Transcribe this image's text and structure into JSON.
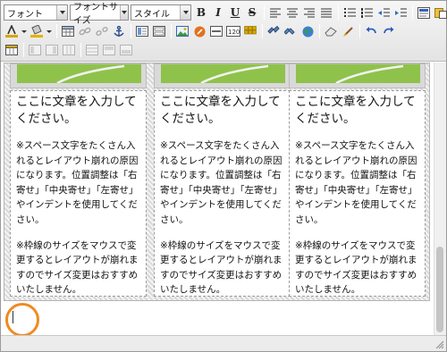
{
  "toolbar": {
    "font_select": "フォント",
    "size_select": "フォントサイズ",
    "style_select": "スタイル",
    "bold_label": "B",
    "italic_label": "I",
    "underline_label": "U",
    "strike_label": "S",
    "icons_row1": [
      "bold-icon",
      "italic-icon",
      "underline-icon",
      "strikethrough-icon",
      "align-left-icon",
      "align-center-icon",
      "align-right-icon",
      "align-justify-icon",
      "bullet-list-icon",
      "numbered-list-icon",
      "outdent-icon",
      "indent-icon",
      "source-icon",
      "paste-icon"
    ],
    "icons_row2": [
      "text-color-icon",
      "background-color-icon",
      "table-icon",
      "link-icon",
      "unlink-icon",
      "anchor-icon",
      "template-icon",
      "form-icon",
      "image-icon",
      "flash-icon",
      "horizontal-rule-icon",
      "number-field-icon",
      "special-char-icon",
      "find-icon",
      "replace-icon",
      "globe-icon",
      "eraser-icon",
      "brush-icon",
      "undo-icon",
      "redo-icon"
    ],
    "icons_row3": [
      "layout-icon",
      "column-insert-before-icon",
      "column-insert-after-icon",
      "column-delete-icon",
      "row-layout-icon",
      "cell-merge-icon",
      "cell-split-icon"
    ]
  },
  "columns": [
    {
      "heading": "ここに文章を入力してください。",
      "note1": "※スペース文字をたくさん入れるとレイアウト崩れの原因になります。位置調整は「右寄せ」「中央寄せ」「左寄せ」やインデントを使用してください。",
      "note2": "※枠線のサイズをマウスで変更するとレイアウトが崩れますのでサイズ変更はおすすめいたしません。"
    },
    {
      "heading": "ここに文章を入力してください。",
      "note1": "※スペース文字をたくさん入れるとレイアウト崩れの原因になります。位置調整は「右寄せ」「中央寄せ」「左寄せ」やインデントを使用してください。",
      "note2": "※枠線のサイズをマウスで変更するとレイアウトが崩れますのでサイズ変更はおすすめいたしません。"
    },
    {
      "heading": "ここに文章を入力してください。",
      "note1": "※スペース文字をたくさん入れるとレイアウト崩れの原因になります。位置調整は「右寄せ」「中央寄せ」「左寄せ」やインデントを使用してください。",
      "note2": "※枠線のサイズをマウスで変更するとレイアウトが崩れますのでサイズ変更はおすすめいたしません。"
    }
  ],
  "colors": {
    "highlight": "#f08a21",
    "image_green": "#8fc24a",
    "toolbar_bg": "#e9e9e9"
  }
}
